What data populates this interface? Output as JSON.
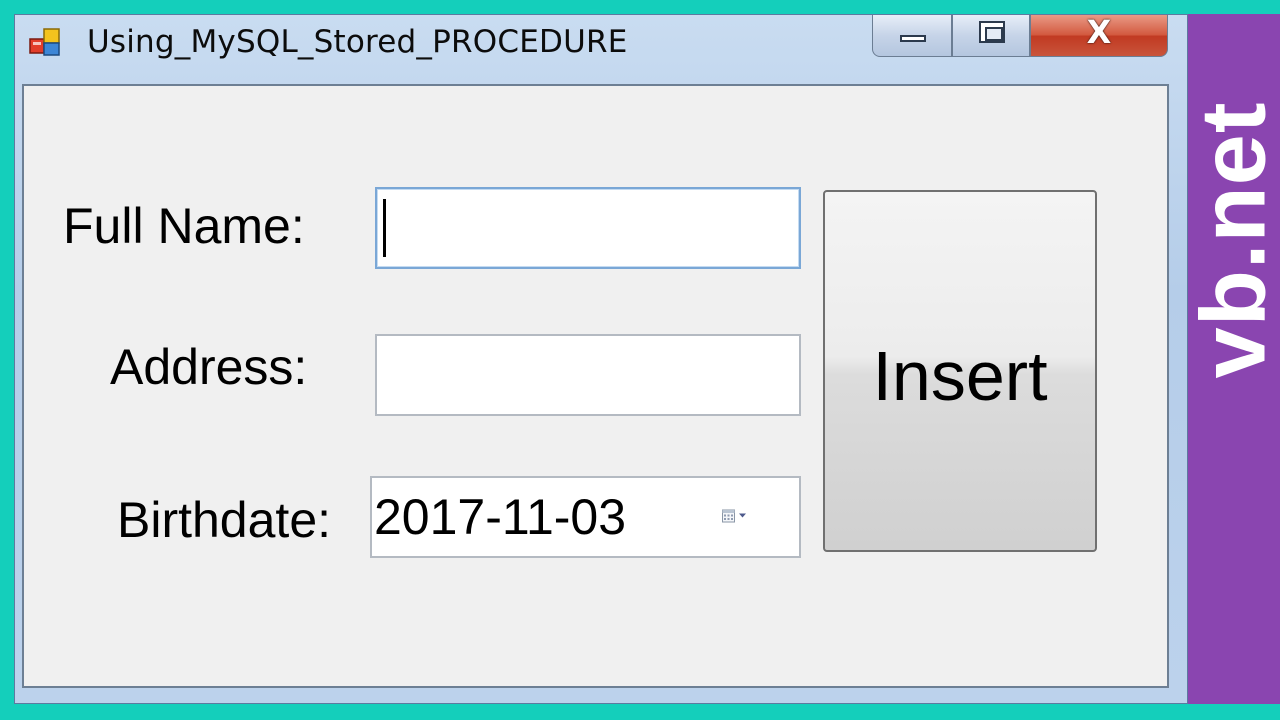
{
  "window": {
    "title": "Using_MySQL_Stored_PROCEDURE",
    "controls": {
      "minimize": "minimize",
      "maximize": "maximize",
      "close": "close"
    }
  },
  "form": {
    "full_name": {
      "label": "Full Name:",
      "value": ""
    },
    "address": {
      "label": "Address:",
      "value": ""
    },
    "birthdate": {
      "label": "Birthdate:",
      "value": "2017-11-03"
    },
    "insert_label": "Insert"
  },
  "brand": {
    "text": "vb.net"
  },
  "colors": {
    "background": "#14cfbb",
    "brand_panel": "#8a45b0",
    "form_back": "#f0f0f0",
    "close_button": "#c9543b"
  },
  "icons": [
    "app-icon",
    "minimize-icon",
    "maximize-icon",
    "close-icon",
    "calendar-dropdown-icon"
  ]
}
